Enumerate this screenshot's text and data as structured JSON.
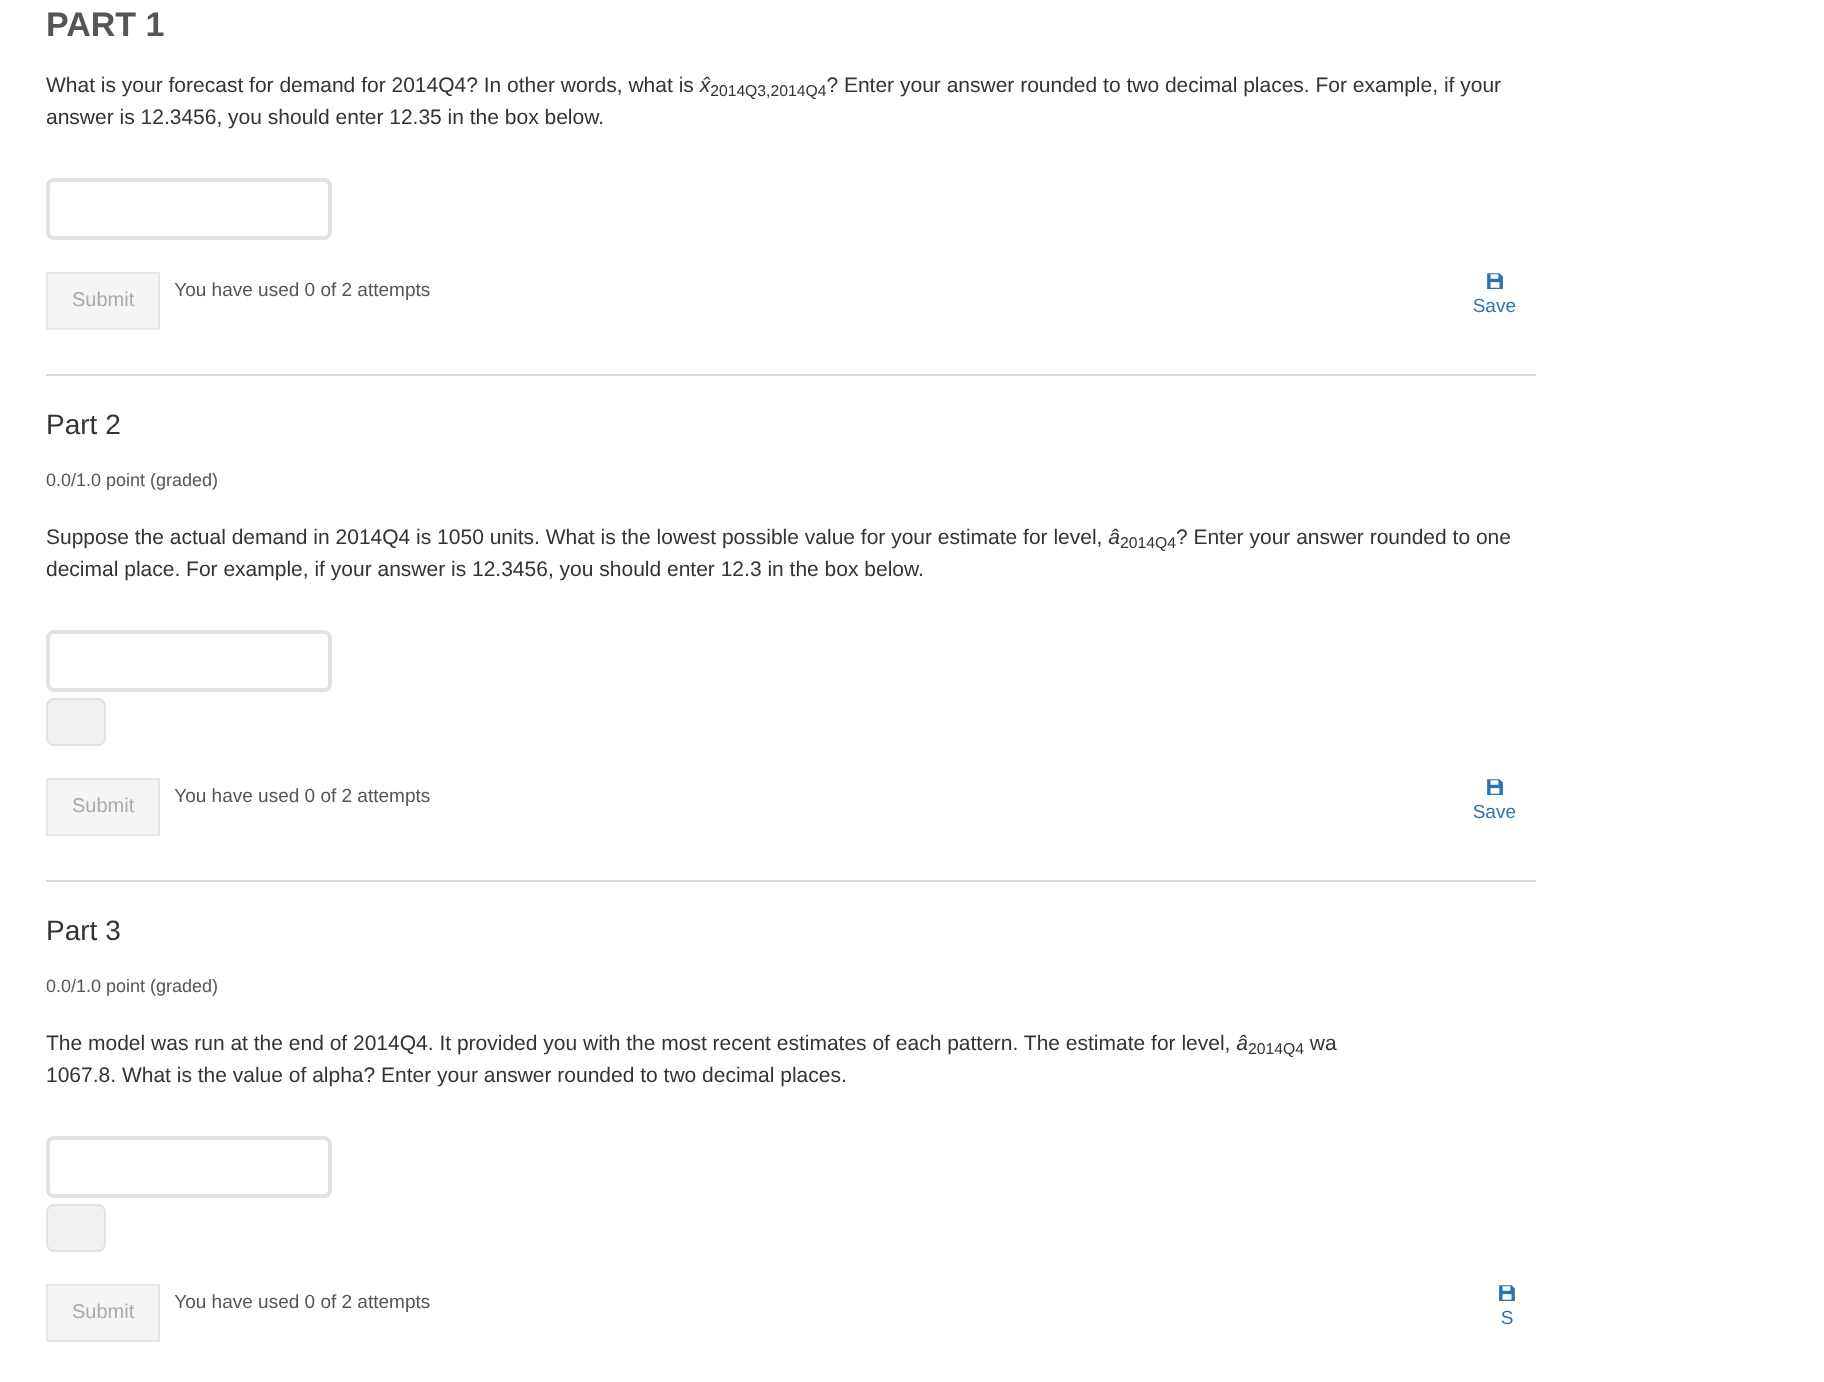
{
  "parts": [
    {
      "title": "PART 1",
      "question": "What is your forecast for demand for 2014Q4? In other words, what is *x̂*$_{2014Q3,2014Q4}$? Enter your answer rounded to two decimal places. For example, if your answer is 12.3456, you should enter 12.35 in the box below.",
      "status_box": false,
      "submit": {
        "label": "Submit",
        "disabled": true
      },
      "attempts": "You have used 0 of 2 attempts",
      "save": "Save"
    },
    {
      "title": "Part 2",
      "points": "0.0/1.0 point (graded)",
      "question": "Suppose the actual demand in 2014Q4 is 1050 units. What is the lowest possible value for your estimate for level, *â*$_{2014Q4}$? Enter your answer rounded to one decimal place. For example, if your answer is 12.3456, you should enter 12.3 in the box below.",
      "status_box": true,
      "submit": {
        "label": "Submit",
        "disabled": true
      },
      "attempts": "You have used 0 of 2 attempts",
      "save": "Save"
    },
    {
      "title": "Part 3",
      "points": "0.0/1.0 point (graded)",
      "question": "The model was run at the end of 2014Q4. It provided you with the most recent estimates of each pattern. The estimate for level, *â*$_{2014Q4}$ wa",
      "question_cont": "1067.8. What is the value of alpha? Enter your answer rounded to two decimal places.",
      "status_box": true,
      "submit": {
        "label": "Submit",
        "disabled": true
      },
      "attempts": "You have used 0 of 2 attempts",
      "save": "S"
    }
  ]
}
